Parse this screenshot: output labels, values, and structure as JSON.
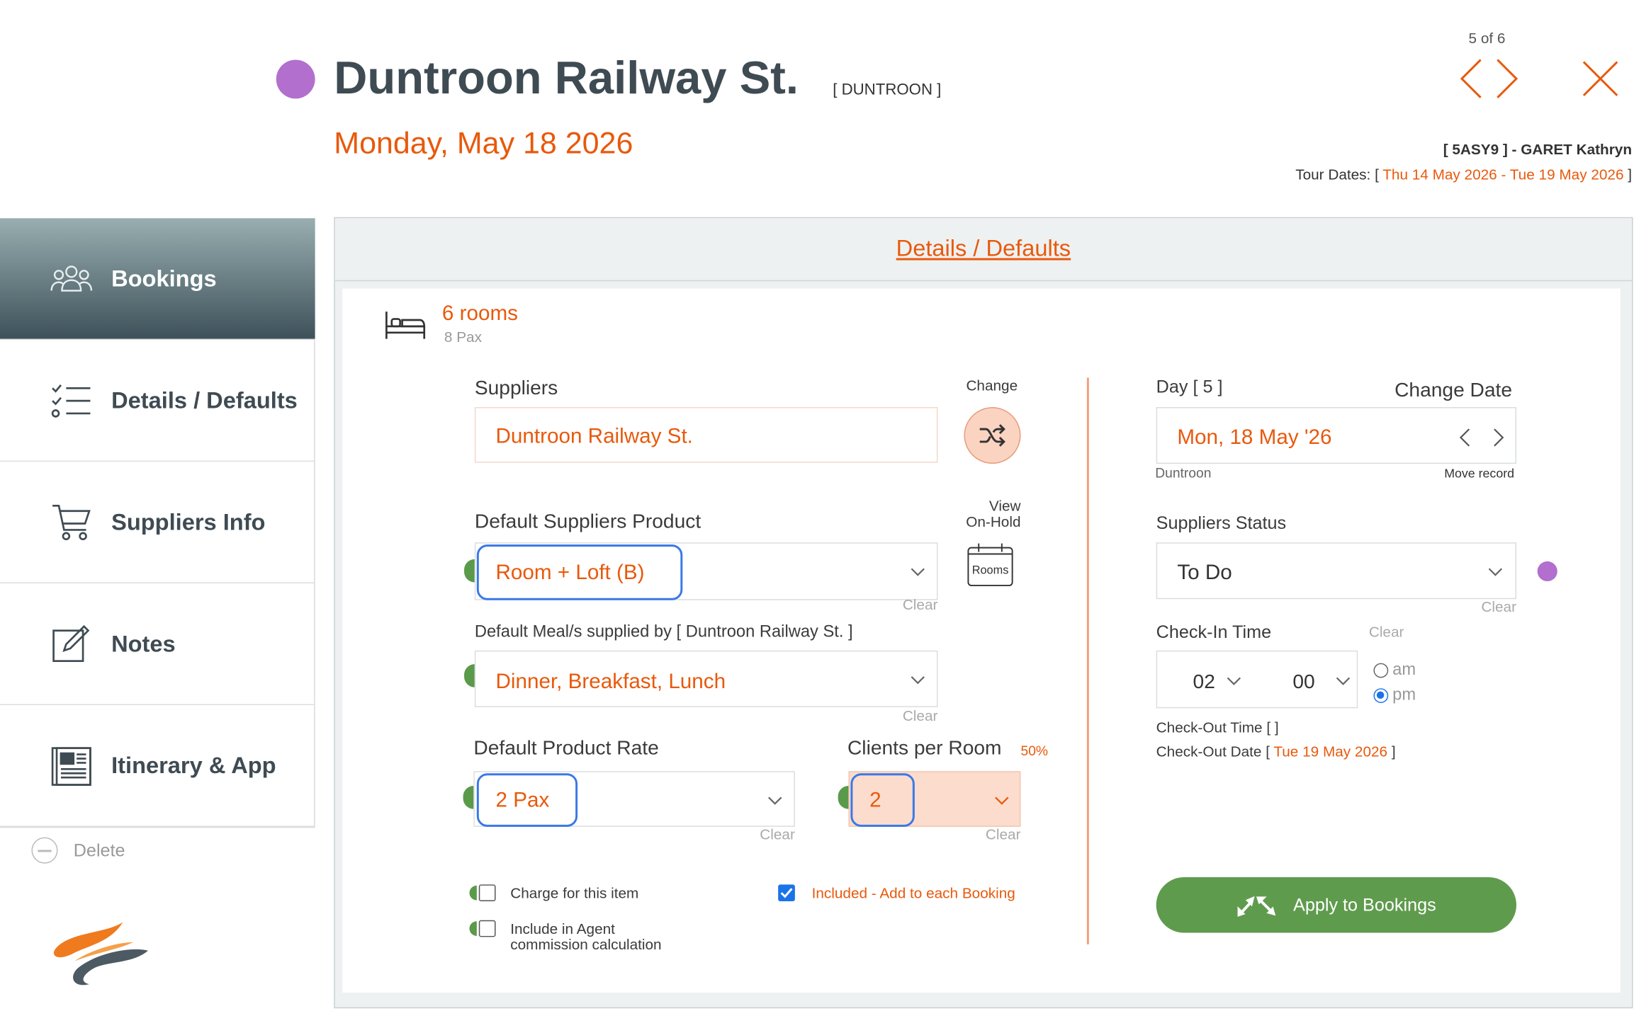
{
  "header": {
    "title": "Duntroon Railway St.",
    "code": "[ DUNTROON ]",
    "date": "Monday, May 18 2026",
    "record_count": "5 of 6",
    "client": "[ 5ASY9 ] - GARET Kathryn",
    "tour_dates_label": "Tour Dates: [",
    "tour_dates_value": "Thu 14 May 2026 - Tue 19 May 2026",
    "tour_dates_end": "]",
    "status_dot_color": "#b26fce"
  },
  "sidebar": {
    "items": [
      {
        "label": "Bookings",
        "icon": "people-group-icon",
        "active": true
      },
      {
        "label": "Details / Defaults",
        "icon": "checklist-icon",
        "active": false
      },
      {
        "label": "Suppliers Info",
        "icon": "shopping-cart-icon",
        "active": false
      },
      {
        "label": "Notes",
        "icon": "edit-note-icon",
        "active": false
      },
      {
        "label": "Itinerary & App",
        "icon": "newspaper-icon",
        "active": false
      }
    ],
    "delete_label": "Delete"
  },
  "panel": {
    "heading": "Details / Defaults",
    "rooms": "6 rooms",
    "pax": "8 Pax"
  },
  "form": {
    "suppliers_label": "Suppliers",
    "supplier_value": "Duntroon Railway St.",
    "change_label": "Change",
    "product_label": "Default Suppliers Product",
    "product_value": "Room + Loft (B)",
    "view_label": "View",
    "onhold_label": "On-Hold",
    "rooms_icon_label": "Rooms",
    "clear": "Clear",
    "meals_label": "Default Meal/s supplied by [ Duntroon Railway St. ]",
    "meals_value": "Dinner, Breakfast, Lunch",
    "rate_label": "Default Product Rate",
    "rate_value": "2 Pax",
    "clients_label": "Clients per Room",
    "clients_pct": "50%",
    "clients_value": "2",
    "charge_label": "Charge for this item",
    "charge_checked": false,
    "commission_label_1": "Include in Agent",
    "commission_label_2": "commission calculation",
    "commission_checked": false,
    "included_label": "Included - Add to each Booking",
    "included_checked": true
  },
  "right": {
    "day_label": "Day [ 5 ]",
    "change_date_label": "Change Date",
    "date_value": "Mon, 18 May '26",
    "location": "Duntroon",
    "move_record": "Move record",
    "status_label": "Suppliers Status",
    "status_value": "To Do",
    "status_dot_color": "#b26fce",
    "checkin_label": "Check-In Time",
    "checkin_clear": "Clear",
    "hour": "02",
    "minute": "00",
    "am": "am",
    "pm": "pm",
    "pm_selected": true,
    "checkout_time": "Check-Out Time [ ]",
    "checkout_date_label": "Check-Out Date [",
    "checkout_date_value": "Tue 19 May 2026",
    "checkout_date_end": "]",
    "apply_label": "Apply to Bookings"
  },
  "colors": {
    "accent": "#e8590c",
    "sidebar_active_top": "#98aeb0",
    "sidebar_active_bottom": "#3e515a",
    "apply_green": "#5f9b4d",
    "focus_blue": "#3a78e8"
  }
}
